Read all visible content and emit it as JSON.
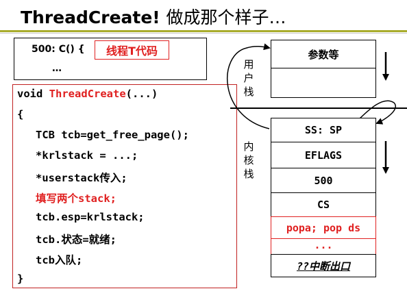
{
  "title": {
    "en": "ThreadCreate!",
    "cn": "做成那个样子…"
  },
  "call_box": {
    "line1": "500: C() {",
    "tag": "线程T代码",
    "dots": "…"
  },
  "code": {
    "line1_kw": "void ",
    "line1_fn": "ThreadCreate",
    "line1_rest": "(...)",
    "open_brace": "{",
    "l2": "TCB tcb=get_free_page();",
    "l3": "*krlstack = ...;",
    "l4": "*userstack传入;",
    "l5": "填写两个stack;",
    "l6": "tcb.esp=krlstack;",
    "l7": "tcb.状态=就绪;",
    "l8": "tcb入队;",
    "close_brace": "}"
  },
  "user_stack": {
    "label": "用户栈",
    "cells": [
      "参数等",
      ""
    ]
  },
  "kernel_stack": {
    "label": "内核栈",
    "cells": [
      "SS: SP",
      "EFLAGS",
      "500",
      "CS",
      "popa; pop ds",
      "...",
      "??中断出口"
    ]
  },
  "colors": {
    "accent_red": "#e02020",
    "rule": "#a8ac2c"
  }
}
